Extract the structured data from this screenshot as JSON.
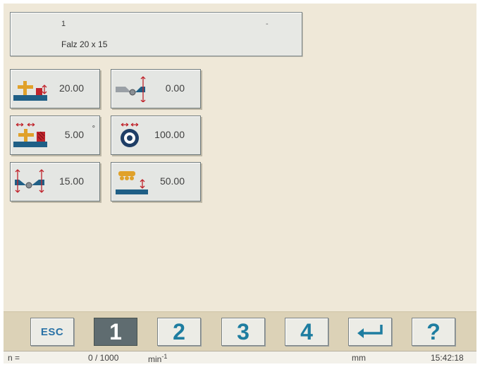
{
  "header": {
    "program_number": "1",
    "dash": "-",
    "program_name": "Falz 20 x 15"
  },
  "params": [
    {
      "icon": "cutter-height-icon",
      "value": "20.00",
      "unit": ""
    },
    {
      "icon": "fence-offset-icon",
      "value": "0.00",
      "unit": ""
    },
    {
      "icon": "tool-angle-icon",
      "value": "5.00",
      "unit": "°"
    },
    {
      "icon": "tool-diameter-icon",
      "value": "100.00",
      "unit": ""
    },
    {
      "icon": "fence-width-icon",
      "value": "15.00",
      "unit": ""
    },
    {
      "icon": "feeder-height-icon",
      "value": "50.00",
      "unit": ""
    }
  ],
  "softkeys": {
    "esc": "ESC",
    "k1": "1",
    "k2": "2",
    "k3": "3",
    "k4": "4",
    "enter_icon": "enter-arrow-icon",
    "help": "?"
  },
  "status": {
    "n_label": "n =",
    "speed": "0 / 1000",
    "speed_unit": "min",
    "speed_unit_exp": "-1",
    "length_unit": "mm",
    "time": "15:42:18"
  },
  "colors": {
    "background": "#efe8d8",
    "accent": "#1e7da0",
    "tool_orange": "#e0a12a",
    "marker_red": "#c0242c",
    "table_blue": "#1f5f86"
  }
}
